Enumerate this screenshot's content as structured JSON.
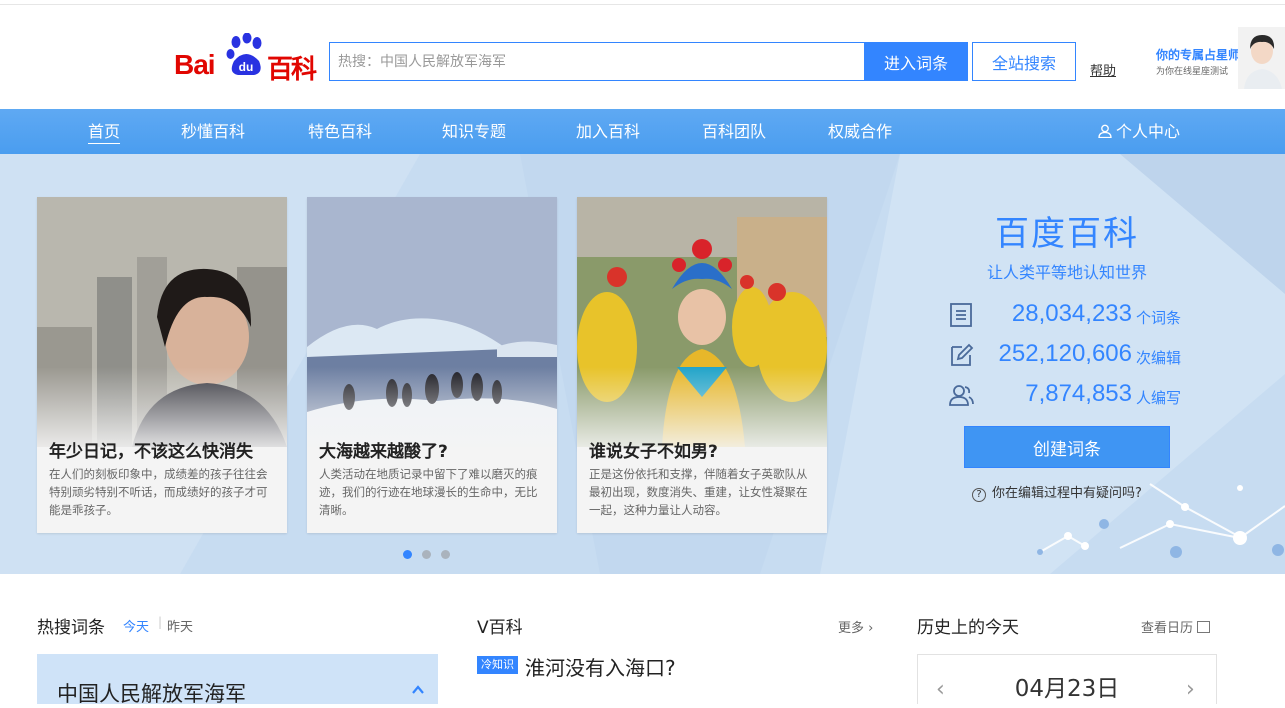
{
  "header": {
    "logo": {
      "text_bai": "Bai",
      "text_du": "du",
      "text_baike": "百科"
    },
    "search": {
      "placeholder": "热搜：中国人民解放军海军",
      "value": ""
    },
    "enter_button": "进入词条",
    "site_search_button": "全站搜索",
    "help": "帮助",
    "promo": {
      "title": "你的专属占星师",
      "subtitle": "为你在线星座测试"
    }
  },
  "nav": {
    "items": [
      "首页",
      "秒懂百科",
      "特色百科",
      "知识专题",
      "加入百科",
      "百科团队",
      "权威合作"
    ],
    "user_center": "个人中心",
    "active_index": 0
  },
  "carousel": {
    "cards": [
      {
        "title": "年少日记，不该这么快消失",
        "desc": "在人们的刻板印象中，成绩差的孩子往往会特别顽劣特别不听话，而成绩好的孩子才可能是乖孩子。"
      },
      {
        "title": "大海越来越酸了?",
        "desc": "人类活动在地质记录中留下了难以磨灭的痕迹，我们的行迹在地球漫长的生命中，无比清晰。"
      },
      {
        "title": "谁说女子不如男?",
        "desc": "正是这份依托和支撑，伴随着女子英歌队从最初出现，数度消失、重建，让女性凝聚在一起，这种力量让人动容。"
      }
    ],
    "dots": 3,
    "active_dot": 0
  },
  "stats": {
    "brand": "百度百科",
    "slogan": "让人类平等地认知世界",
    "rows": [
      {
        "icon": "document-icon",
        "value": "28,034,233",
        "unit": "个词条"
      },
      {
        "icon": "edit-icon",
        "value": "252,120,606",
        "unit": "次编辑"
      },
      {
        "icon": "users-icon",
        "value": "7,874,853",
        "unit": "人编写"
      }
    ],
    "create_button": "创建词条",
    "faq": "你在编辑过程中有疑问吗?",
    "faq_mark": "?"
  },
  "hot": {
    "title": "热搜词条",
    "today": "今天",
    "sep": "|",
    "yesterday": "昨天",
    "top_item": "中国人民解放军海军"
  },
  "vbaike": {
    "title": "V百科",
    "more": "更多",
    "tag": "冷知识",
    "headline": "淮河没有入海口?"
  },
  "history": {
    "title": "历史上的今天",
    "calendar_link": "查看日历",
    "date": "04月23日",
    "prev": "‹",
    "next": "›"
  },
  "colors": {
    "accent": "#3385ff",
    "nav": "#5aa8f2",
    "logo_red": "#e10601",
    "hero_bg": "#c9ddf1"
  }
}
